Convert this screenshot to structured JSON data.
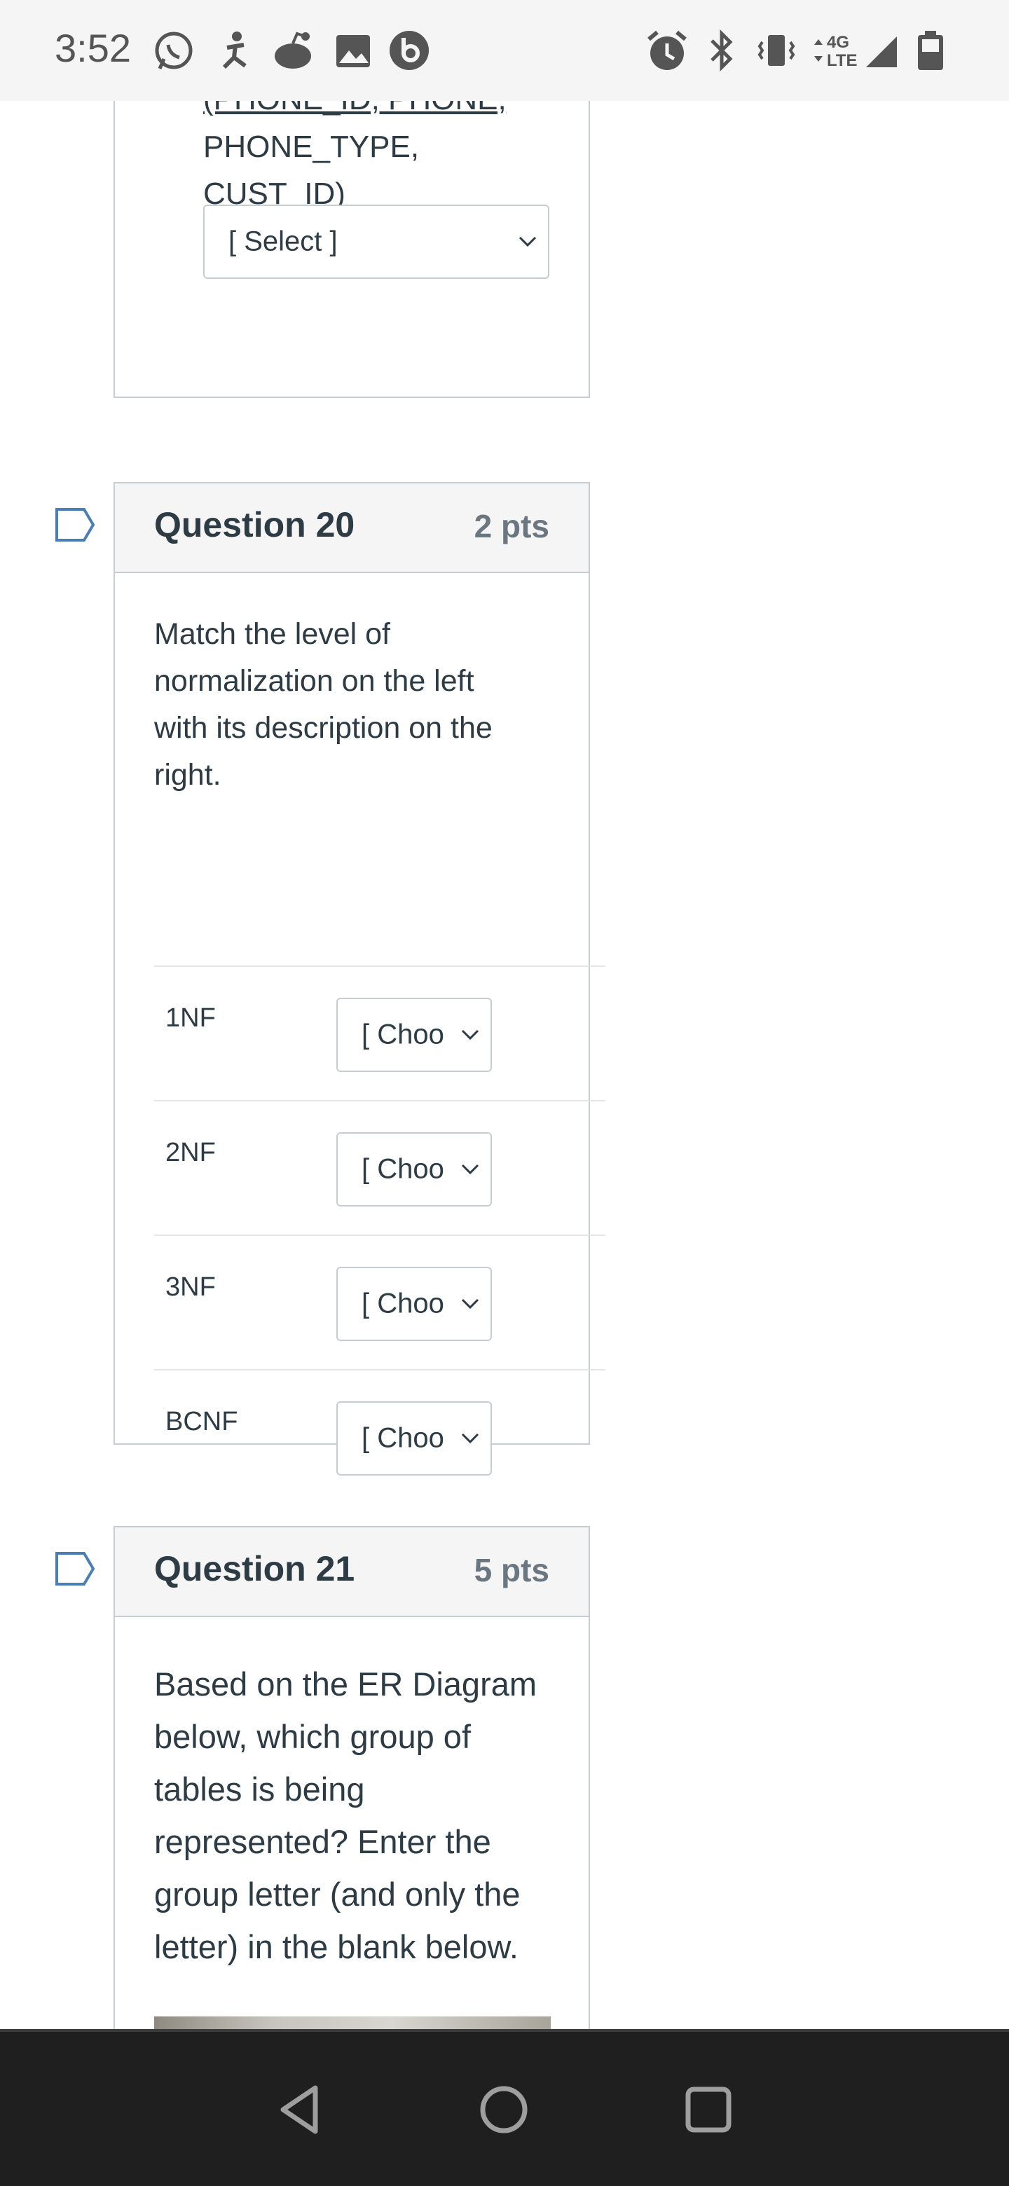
{
  "status_bar": {
    "time": "3:52",
    "left_icons": [
      "whatsapp-icon",
      "accessibility-icon",
      "reddit-icon",
      "image-icon",
      "beats-icon"
    ],
    "right_icons": [
      "alarm-icon",
      "bluetooth-icon",
      "vibrate-icon",
      "network-4g-lte-icon",
      "signal-icon",
      "battery-icon"
    ],
    "network_label_top": "4G",
    "network_label_bottom": "LTE"
  },
  "previous_question": {
    "cut_text": "(PHONE_ID, PHONE,",
    "text_lines": [
      "PHONE_TYPE,",
      "CUST_ID)"
    ],
    "select_value": "[ Select ]"
  },
  "question_20": {
    "title": "Question 20",
    "points": "2 pts",
    "prompt_lines": [
      "Match the level of",
      "normalization on the left",
      "with its description on the",
      "right."
    ],
    "rows": [
      {
        "label": "1NF",
        "select_value": "[ Choo"
      },
      {
        "label": "2NF",
        "select_value": "[ Choo"
      },
      {
        "label": "3NF",
        "select_value": "[ Choo"
      },
      {
        "label": "BCNF",
        "select_value": "[ Choo"
      }
    ]
  },
  "question_21": {
    "title": "Question 21",
    "points": "5 pts",
    "prompt_lines": [
      "Based on the ER Diagram",
      "below, which group of",
      "tables is being",
      "represented? Enter the",
      "group letter (and only the",
      "letter) in the blank below."
    ]
  },
  "nav_bar": {
    "buttons": [
      "back-icon",
      "home-icon",
      "recents-icon"
    ]
  },
  "colors": {
    "text": "#2d3b45",
    "muted": "#6b7780",
    "border": "#c7cdd1",
    "header_bg": "#f5f5f5",
    "flag": "#4a7fb5",
    "nav_bg": "#1f1f1f"
  }
}
